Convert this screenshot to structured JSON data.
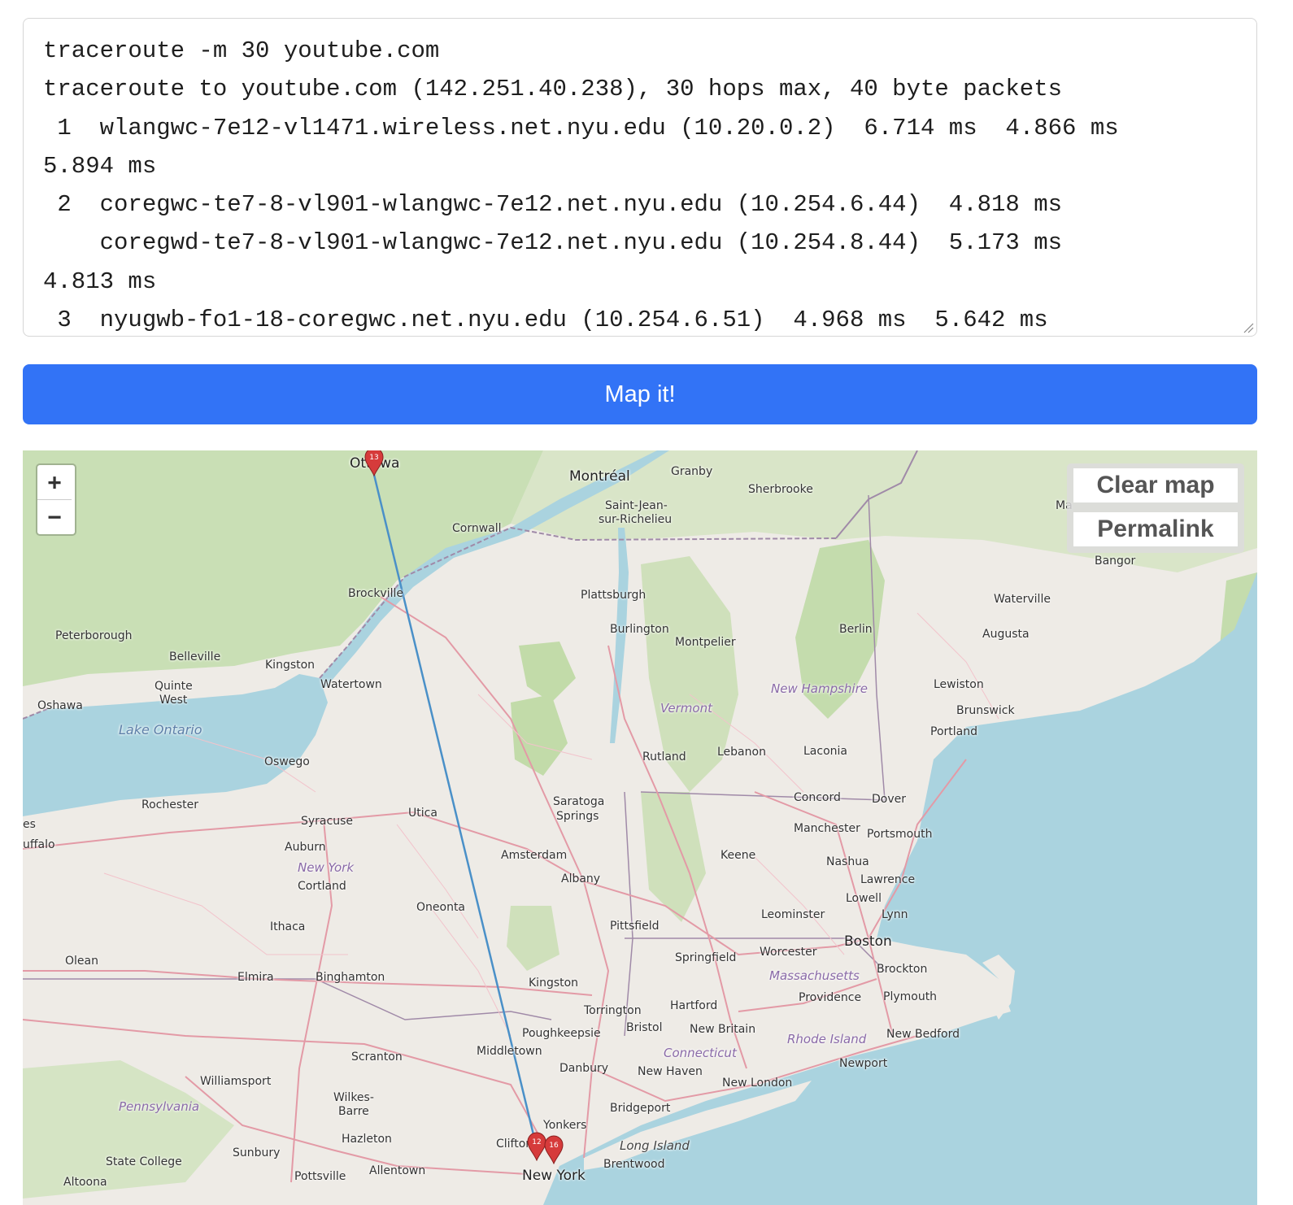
{
  "traceroute": {
    "lines": [
      "traceroute -m 30 youtube.com",
      "traceroute to youtube.com (142.251.40.238), 30 hops max, 40 byte packets",
      " 1  wlangwc-7e12-vl1471.wireless.net.nyu.edu (10.20.0.2)  6.714 ms  4.866 ms",
      "5.894 ms",
      " 2  coregwc-te7-8-vl901-wlangwc-7e12.net.nyu.edu (10.254.6.44)  4.818 ms",
      "    coregwd-te7-8-vl901-wlangwc-7e12.net.nyu.edu (10.254.8.44)  5.173 ms",
      "4.813 ms",
      " 3  nyugwb-fo1-18-coregwc.net.nyu.edu (10.254.6.51)  4.968 ms  5.642 ms"
    ]
  },
  "map_button": {
    "label": "Map it!"
  },
  "map": {
    "zoom_in": "+",
    "zoom_out": "−",
    "clear_label": "Clear map",
    "permalink_label": "Permalink",
    "route_color": "#4a90c8",
    "marker_color": "#d63b3b",
    "markers": [
      {
        "label": "13",
        "place": "Ottawa"
      },
      {
        "label": "12",
        "place": "Clifton"
      },
      {
        "label": "16",
        "place": "New York"
      }
    ],
    "place_labels": {
      "ottawa": "Ottawa",
      "montreal": "Montréal",
      "granby": "Granby",
      "sherbrooke": "Sherbrooke",
      "saint_jean": "Saint-Jean-",
      "sur_richelieu": "sur-Richelieu",
      "cornwall": "Cornwall",
      "brockville": "Brockville",
      "plattsburgh": "Plattsburgh",
      "burlington": "Burlington",
      "montpelier": "Montpelier",
      "berlin": "Berlin",
      "waterville": "Waterville",
      "augusta": "Augusta",
      "bangor": "Bangor",
      "peterborough": "Peterborough",
      "belleville": "Belleville",
      "kingston_on": "Kingston",
      "quinte": "Quinte",
      "west": "West",
      "oshawa": "Oshawa",
      "watertown": "Watertown",
      "lake_ontario": "Lake Ontario",
      "new_hampshire": "New Hampshire",
      "lewiston": "Lewiston",
      "brunswick": "Brunswick",
      "portland": "Portland",
      "vermont": "Vermont",
      "rutland": "Rutland",
      "lebanon": "Lebanon",
      "laconia": "Laconia",
      "oswego": "Oswego",
      "rochester": "Rochester",
      "utica": "Utica",
      "saratoga": "Saratoga",
      "springs": "Springs",
      "concord": "Concord",
      "dover": "Dover",
      "syracuse": "Syracuse",
      "manchester": "Manchester",
      "portsmouth": "Portsmouth",
      "buffalo": "uffalo",
      "auburn": "Auburn",
      "amsterdam": "Amsterdam",
      "keene": "Keene",
      "nashua": "Nashua",
      "new_york_state": "New York",
      "albany": "Albany",
      "lawrence": "Lawrence",
      "cortland": "Cortland",
      "lowell": "Lowell",
      "oneonta": "Oneonta",
      "leominster": "Leominster",
      "lynn": "Lynn",
      "ithaca": "Ithaca",
      "pittsfield": "Pittsfield",
      "boston": "Boston",
      "olean": "Olean",
      "springfield": "Springfield",
      "worcester": "Worcester",
      "elmira": "Elmira",
      "binghamton": "Binghamton",
      "massachusetts": "Massachusetts",
      "brockton": "Brockton",
      "kingston_ny": "Kingston",
      "providence": "Providence",
      "plymouth": "Plymouth",
      "torrington": "Torrington",
      "hartford": "Hartford",
      "bristol": "Bristol",
      "new_britain": "New Britain",
      "poughkeepsie": "Poughkeepsie",
      "rhode_island": "Rhode Island",
      "new_bedford": "New Bedford",
      "scranton": "Scranton",
      "middletown": "Middletown",
      "connecticut": "Connecticut",
      "danbury": "Danbury",
      "newport": "Newport",
      "new_haven": "New Haven",
      "new_london": "New London",
      "williamsport": "Williamsport",
      "pennsylvania": "Pennsylvania",
      "wilkes": "Wilkes-",
      "barre": "Barre",
      "bridgeport": "Bridgeport",
      "yonkers": "Yonkers",
      "hazleton": "Hazleton",
      "clifton": "Clifton",
      "long_island": "Long Island",
      "state_college": "State College",
      "sunbury": "Sunbury",
      "brentwood": "Brentwood",
      "pottsville": "Pottsville",
      "allentown": "Allentown",
      "new_york_city": "New York",
      "altoona": "Altoona",
      "ma": "Ma",
      "es": "es"
    }
  }
}
